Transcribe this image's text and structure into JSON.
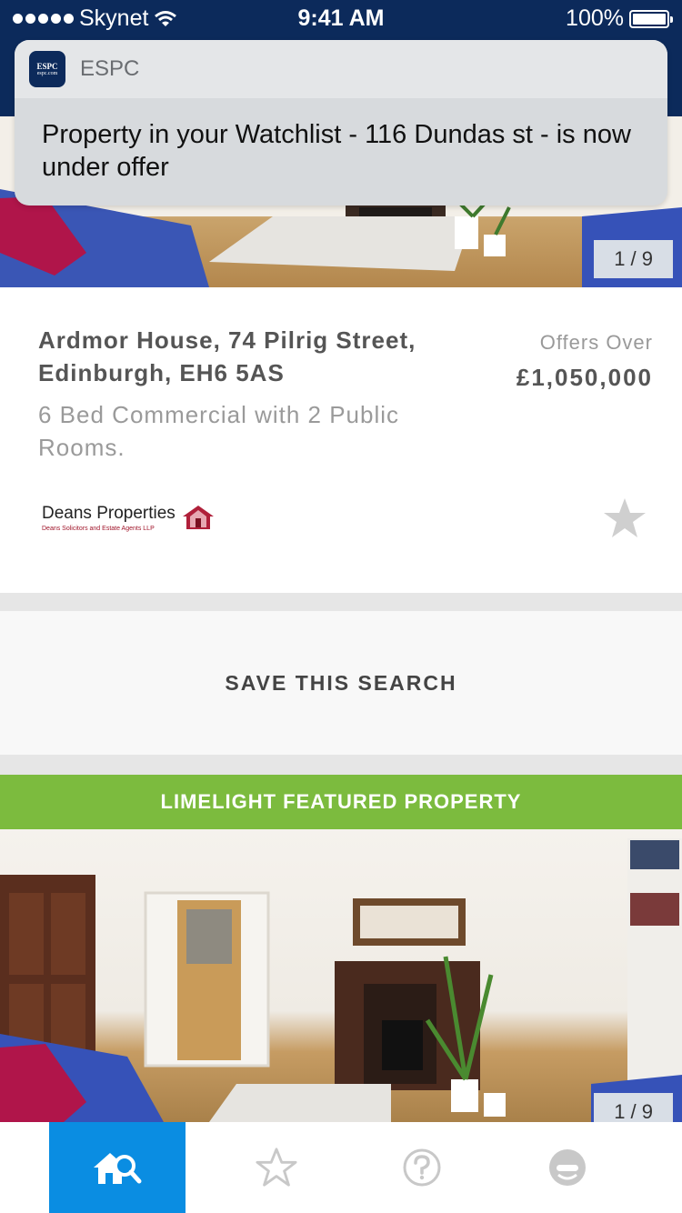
{
  "status_bar": {
    "carrier": "Skynet",
    "time": "9:41 AM",
    "battery": "100%",
    "battery_level": 1.0
  },
  "notification": {
    "app_name": "ESPC",
    "icon_text_top": "ESPC",
    "icon_text_bottom": "espc.com",
    "message": "Property in your Watchlist - 116 Dundas st - is now under offer"
  },
  "listing_1": {
    "photo_counter": "1 / 9",
    "address": "Ardmor House, 74 Pilrig Street, Edinburgh, EH6 5AS",
    "description": "6 Bed Commercial with 2 Public Rooms.",
    "price_label": "Offers Over",
    "price": "£1,050,000",
    "agent_name": "Deans Properties",
    "agent_subtitle": "Deans Solicitors and Estate Agents LLP"
  },
  "save_search_label": "SAVE THIS SEARCH",
  "featured": {
    "banner": "LIMELIGHT FEATURED PROPERTY",
    "photo_counter": "1 / 9"
  },
  "tab_bar": {
    "active": "search",
    "tabs": [
      {
        "id": "search",
        "icon": "house-search-icon"
      },
      {
        "id": "watchlist",
        "icon": "star-icon"
      },
      {
        "id": "help",
        "icon": "question-icon"
      },
      {
        "id": "account",
        "icon": "user-icon"
      }
    ]
  },
  "colors": {
    "header_navy": "#0c2a5b",
    "featured_green": "#7cbb3e",
    "tab_active_blue": "#0a8de2",
    "agent_red": "#a0152a"
  }
}
